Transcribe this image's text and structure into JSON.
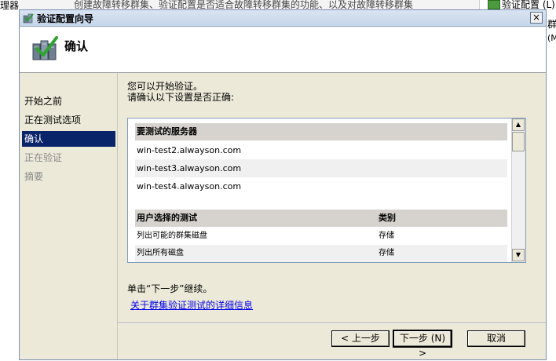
{
  "background": {
    "left_label": "理器",
    "strip_text": "创建故障转移群集、验证配置是否适合故障转移群集的功能、以及对故障转移群集",
    "right_title": "验证配置 (L)",
    "right_line1": "群",
    "right_line2": "(M)"
  },
  "dialog": {
    "title": "验证配置向导",
    "close_label": "×",
    "header_title": "确认"
  },
  "sidebar": {
    "items": [
      {
        "label": "开始之前"
      },
      {
        "label": "正在测试选项"
      },
      {
        "label": "确认"
      },
      {
        "label": "正在验证"
      },
      {
        "label": "摘要"
      }
    ]
  },
  "main": {
    "intro_line1": "您可以开始验证。",
    "intro_line2": "请确认以下设置是否正确:",
    "servers_heading": "要测试的服务器",
    "servers": [
      "win-test2.alwayson.com",
      "win-test3.alwayson.com",
      "win-test4.alwayson.com"
    ],
    "tests_heading": "用户选择的测试",
    "tests_category_heading": "类别",
    "tests": [
      {
        "name": "列出可能的群集磁盘",
        "category": "存储"
      },
      {
        "name": "列出所有磁盘",
        "category": "存储"
      }
    ],
    "continue_text": "单击“下一步”继续。",
    "more_info_link": "关于群集验证测试的详细信息"
  },
  "footer": {
    "back_label": "< 上一步",
    "next_label": "下一步 (N) >",
    "cancel_label": "取消"
  }
}
